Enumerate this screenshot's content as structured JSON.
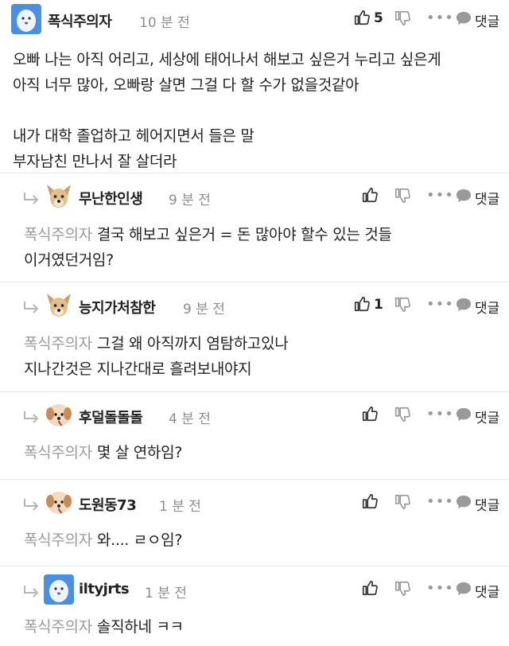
{
  "comments": [
    {
      "nickname": "폭식주의자",
      "time": "10 분 전",
      "likes": "5",
      "reply_label": "댓글",
      "lines": [
        "오빠 나는 아직 어리고, 세상에 태어나서 해보고 싶은거 누리고 싶은게",
        "아직 너무 많아, 오빠랑 살면 그걸 다 할 수가 없을것같아"
      ],
      "lines2": [
        "내가 대학 졸업하고 헤어지면서 들은 말",
        "부자남친 만나서 잘 살더라"
      ]
    },
    {
      "nickname": "무난한인생",
      "time": "9 분 전",
      "reply_label": "댓글",
      "mention": "폭식주의자",
      "text1": "결국 해보고 싶은거 = 돈 많아야 할수 있는 것들",
      "text2": "이거였던거임?"
    },
    {
      "nickname": "능지가처참한",
      "time": "9 분 전",
      "likes": "1",
      "reply_label": "댓글",
      "mention": "폭식주의자",
      "text1": "그걸 왜 아직까지 염탐하고있나",
      "text2": "지나간것은 지나간대로 흘려보내야지"
    },
    {
      "nickname": "후덜돌돌돌",
      "time": "4 분 전",
      "reply_label": "댓글",
      "mention": "폭식주의자",
      "text1": "몇 살 연하임?"
    },
    {
      "nickname": "도원동73",
      "time": "1 분 전",
      "reply_label": "댓글",
      "mention": "폭식주의자",
      "text1": "와.... ㄹㅇ임?"
    },
    {
      "nickname": "iltyjrts",
      "time": "1 분 전",
      "reply_label": "댓글",
      "mention": "폭식주의자",
      "text1": "솔직하네 ㅋㅋ"
    }
  ],
  "icons": {
    "like": "thumbs-up-icon",
    "dislike": "thumbs-down-icon",
    "more": "more-dots-icon",
    "reply": "speech-bubble-icon",
    "reply_arrow": "reply-arrow-icon"
  },
  "colors": {
    "text": "#222222",
    "muted": "#8e8e8e",
    "divider": "#e9e9e9"
  }
}
